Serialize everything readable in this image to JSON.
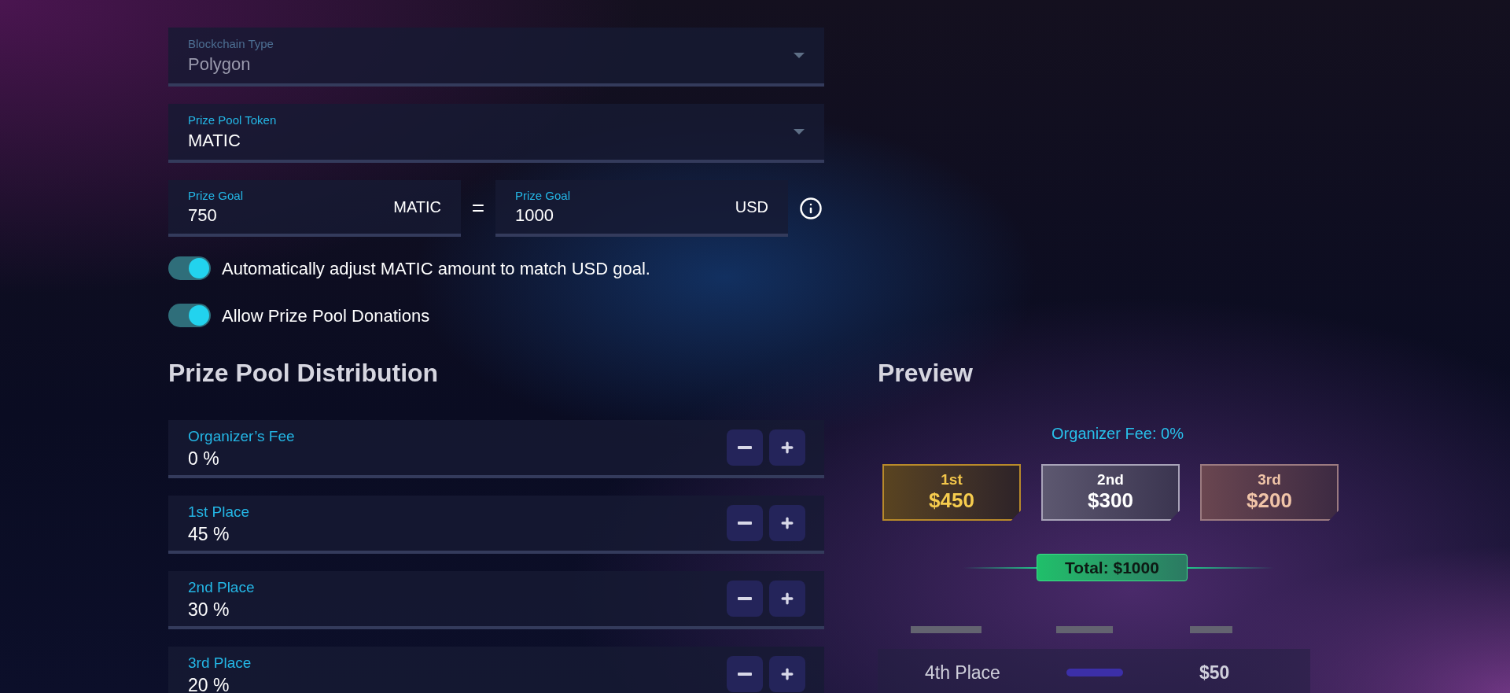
{
  "fields": [
    {
      "label": "Blockchain Type",
      "value": "Polygon",
      "disabled": true
    },
    {
      "label": "Prize Pool Token",
      "value": "MATIC",
      "disabled": false
    }
  ],
  "prize_goal": {
    "left": {
      "label": "Prize Goal",
      "value": "750",
      "unit": "MATIC"
    },
    "equals": "=",
    "right": {
      "label": "Prize Goal",
      "value": "1000",
      "unit": "USD"
    }
  },
  "toggles": [
    {
      "label": "Automatically adjust MATIC amount to match USD goal.",
      "on": true
    },
    {
      "label": "Allow Prize Pool Donations",
      "on": true
    }
  ],
  "distribution": {
    "title": "Prize Pool Distribution",
    "rows": [
      {
        "label": "Organizer’s Fee",
        "value": "0 %"
      },
      {
        "label": "1st Place",
        "value": "45 %"
      },
      {
        "label": "2nd Place",
        "value": "30 %"
      },
      {
        "label": "3rd Place",
        "value": "20 %"
      }
    ]
  },
  "preview": {
    "title": "Preview",
    "organizer_fee": "Organizer Fee: 0%",
    "places": [
      {
        "place": "1st",
        "amount": "$450",
        "kind": "gold"
      },
      {
        "place": "2nd",
        "amount": "$300",
        "kind": "silver"
      },
      {
        "place": "3rd",
        "amount": "$200",
        "kind": "bronze"
      }
    ],
    "total": "Total: $1000",
    "rows": [
      {
        "place": "4th Place",
        "amount": "$50"
      }
    ]
  }
}
